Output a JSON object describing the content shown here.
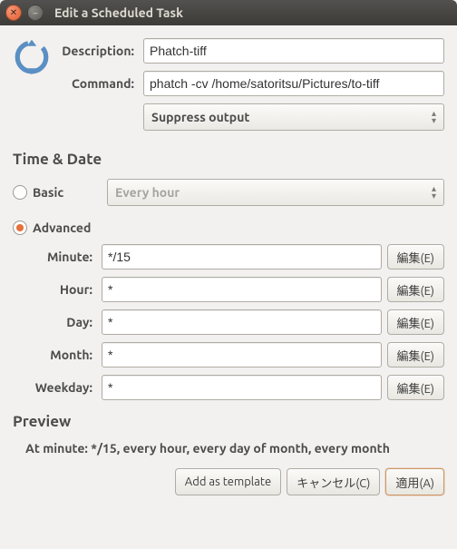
{
  "window": {
    "title": "Edit a Scheduled Task"
  },
  "top": {
    "description_label": "Description:",
    "description_value": "Phatch-tiff",
    "command_label": "Command:",
    "command_value": "phatch -cv /home/satoritsu/Pictures/to-tiff",
    "output_select": "Suppress output"
  },
  "sections": {
    "timedate": "Time & Date",
    "preview": "Preview"
  },
  "mode": {
    "basic_label": "Basic",
    "basic_dropdown": "Every hour",
    "advanced_label": "Advanced"
  },
  "adv": {
    "minute_label": "Minute:",
    "minute_value": "*/15",
    "hour_label": "Hour:",
    "hour_value": "*",
    "day_label": "Day:",
    "day_value": "*",
    "month_label": "Month:",
    "month_value": "*",
    "weekday_label": "Weekday:",
    "weekday_value": "*",
    "edit_btn": "編集(E)"
  },
  "preview_text": "At minute: */15, every hour, every day of month, every month",
  "buttons": {
    "template": "Add as template",
    "cancel": "キャンセル(C)",
    "apply": "適用(A)"
  }
}
